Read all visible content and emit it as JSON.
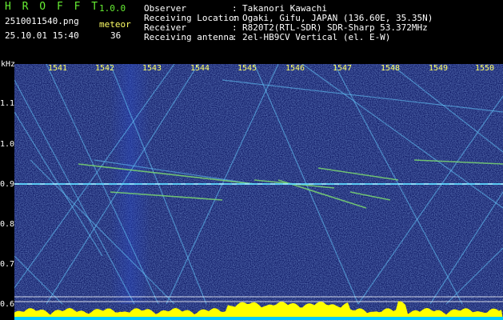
{
  "header": {
    "app_name": "H R O F F T",
    "version": "1.0.0",
    "filename": "2510011540.png",
    "datetime": "25.10.01 15:40",
    "meteor_label": "meteor",
    "meteor_count": "36",
    "info": [
      {
        "label": "Observer",
        "sep": ":",
        "value": "Takanori Kawachi"
      },
      {
        "label": "Receiving Location",
        "sep": ":",
        "value": "Ogaki, Gifu, JAPAN (136.60E, 35.35N)"
      },
      {
        "label": "Receiver",
        "sep": ":",
        "value": "R820T2(RTL-SDR) SDR-Sharp 53.372MHz"
      },
      {
        "label": "Receiving antenna",
        "sep": ":",
        "value": "2el-HB9CV Vertical (el. E-W)"
      }
    ]
  },
  "spectrogram": {
    "y_unit": "kHz",
    "y_ticks": [
      "1.1",
      "1.0",
      "0.9",
      "0.8",
      "0.7",
      "0.6"
    ],
    "x_ticks": [
      "1541",
      "1542",
      "1543",
      "1544",
      "1545",
      "1546",
      "1547",
      "1548",
      "1549",
      "1550"
    ],
    "colors": {
      "background": "#0a1460",
      "trace": "#66ccff",
      "signal": "#ffffff",
      "histogram": "#ffff00",
      "hist_base": "#00ccff"
    }
  }
}
